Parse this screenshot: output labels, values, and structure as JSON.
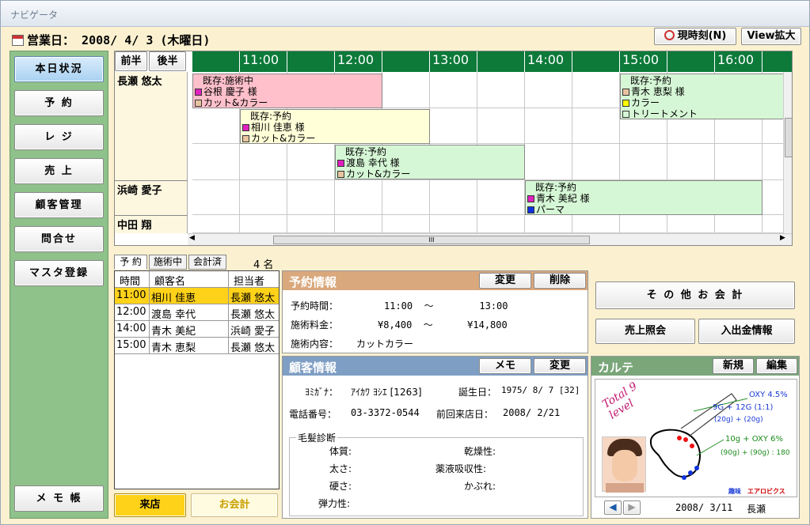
{
  "window": {
    "title": "ナビゲータ"
  },
  "header": {
    "business_date_label": "営業日：",
    "business_date": "2008/ 4/ 3 (木曜日)",
    "now_button": "現時刻(N)",
    "view_button": "View拡大"
  },
  "sidebar": {
    "items": [
      {
        "label": "本日状況"
      },
      {
        "label": "予 約"
      },
      {
        "label": "レ ジ"
      },
      {
        "label": "売 上"
      },
      {
        "label": "顧客管理"
      },
      {
        "label": "問合せ"
      },
      {
        "label": "マスタ登録"
      }
    ],
    "memo_label": "メ モ 帳"
  },
  "schedule": {
    "first_half": "前半",
    "second_half": "後半",
    "hours": [
      "11:00",
      "12:00",
      "13:00",
      "14:00",
      "15:00",
      "16:00"
    ],
    "staff": [
      "長瀬 悠太",
      "浜崎 愛子",
      "中田 翔"
    ],
    "appointments": [
      {
        "status": "既存:施術中",
        "name": "谷根 慶子 様",
        "items": [
          "カット&カラー"
        ]
      },
      {
        "status": "既存:予約",
        "name": "相川 佳恵 様",
        "items": [
          "カット&カラー"
        ]
      },
      {
        "status": "既存:予約",
        "name": "渡島 幸代 様",
        "items": [
          "カット&カラー"
        ]
      },
      {
        "status": "既存:予約",
        "name": "青木 恵梨 様",
        "items": [
          "カラー",
          "トリートメント"
        ]
      },
      {
        "status": "既存:予約",
        "name": "青木 美紀 様",
        "items": [
          "パーマ"
        ]
      }
    ],
    "scroll_mark": "III"
  },
  "list": {
    "tabs": [
      "予 約",
      "施術中",
      "会計済"
    ],
    "count": "4 名",
    "headers": [
      "時間",
      "顧客名",
      "担当者"
    ],
    "rows": [
      [
        "11:00",
        "相川 佳恵",
        "長瀬 悠太"
      ],
      [
        "12:00",
        "渡島 幸代",
        "長瀬 悠太"
      ],
      [
        "14:00",
        "青木 美紀",
        "浜崎 愛子"
      ],
      [
        "15:00",
        "青木 恵梨",
        "長瀬 悠太"
      ]
    ],
    "checkin_button": "来店",
    "checkout_button": "お会計"
  },
  "reservation": {
    "title": "予約情報",
    "change_button": "変更",
    "delete_button": "削除",
    "time_label": "予約時間：",
    "time_value": "11:00  ～        13:00",
    "fee_label": "施術料金：",
    "fee_value": "¥8,400  ～      ¥14,800",
    "content_label": "施術内容：",
    "content_value": "カットカラー"
  },
  "actions": {
    "other_payment": "そ の 他 お 会 計",
    "sales_inquiry": "売上照会",
    "cash_info": "入出金情報"
  },
  "customer": {
    "title": "顧客情報",
    "memo_button": "メモ",
    "change_button": "変更",
    "kana_label": "ﾖﾐｶﾞﾅ：",
    "kana_value": "ｱｲｶﾜ ﾖｼｴ [1263]",
    "birthday_label": "誕生日：",
    "birthday_value": "1975/ 8/ 7 [32]",
    "phone_label": "電話番号：",
    "phone_value": "03-3372-0544",
    "last_visit_label": "前回来店日：",
    "last_visit_value": "2008/ 2/21",
    "hair_title": "毛髪診断",
    "hair_fields": [
      "体質:",
      "太さ:",
      "硬さ:",
      "弾力性:"
    ],
    "hair_fields_right": [
      "乾燥性:",
      "薬液吸収性:",
      "かぶれ:"
    ]
  },
  "karte": {
    "title": "カルテ",
    "new_button": "新規",
    "edit_button": "編集",
    "handwriting_left": "Total 9 level",
    "formula1": "OXY 4.5%",
    "formula2": "9G + 12G (1:1)",
    "formula3": "(20g) + (20g)",
    "formula4": "10g + OXY 6%",
    "formula5": "(90g) + (90g) : 180",
    "hobby_label": "趣味",
    "hobby_value": "エアロビクス",
    "date": "2008/ 3/11",
    "staff": "長瀬"
  },
  "colors": {
    "hour_bar": "#0d7a3a",
    "sidebar_bg": "#8fc18a",
    "panel_reservation": "#d9a87c",
    "panel_customer": "#7f9ec4",
    "panel_karte": "#7aa67a",
    "appt_active": "#ffc0cb",
    "appt_yellow": "#ffffd8",
    "appt_green": "#d6f7d6",
    "selected_row": "#ffd21a"
  }
}
